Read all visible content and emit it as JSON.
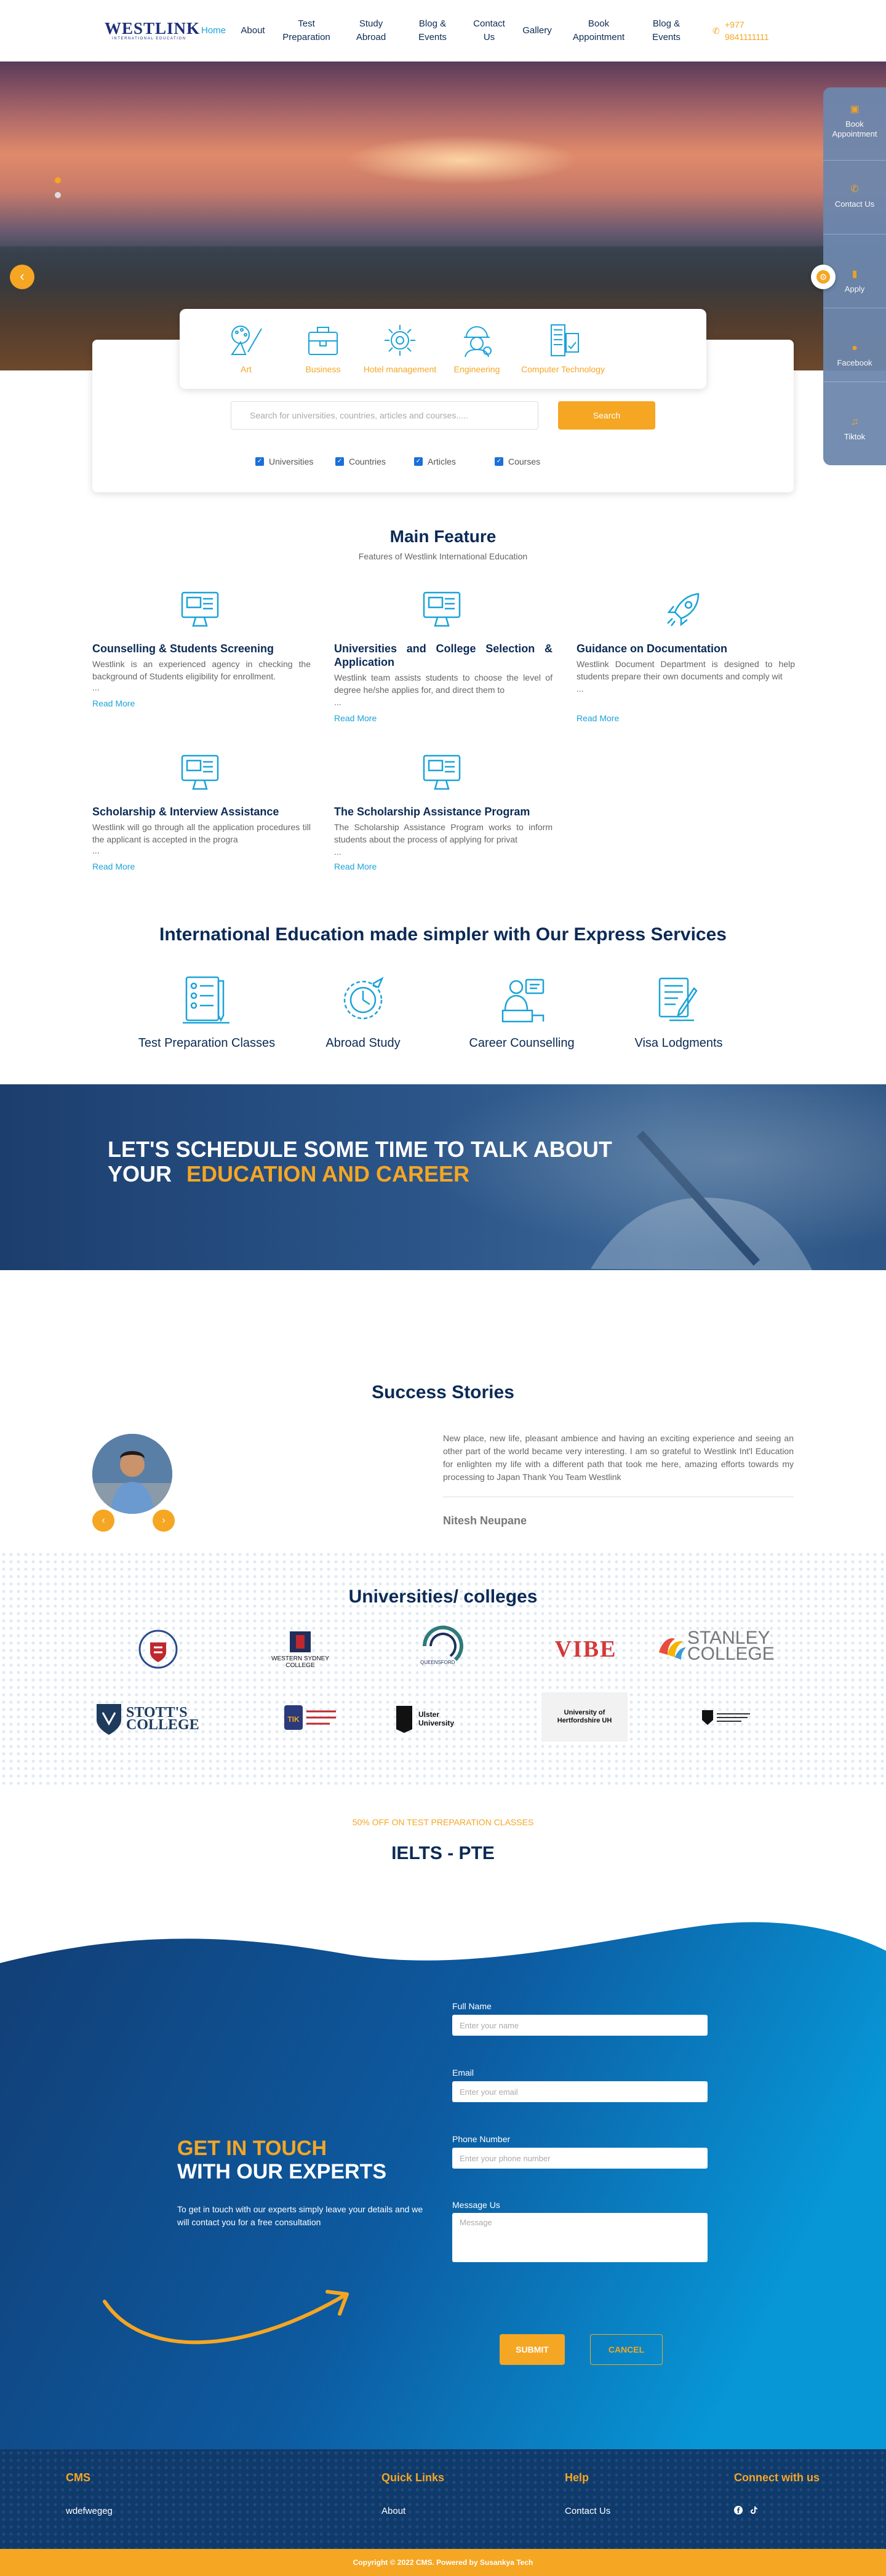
{
  "header": {
    "logo_main": "WESTLINK",
    "logo_sub": "INTERNATIONAL EDUCATION",
    "nav": [
      {
        "label": "Home"
      },
      {
        "label": "About"
      },
      {
        "label": "Test\nPreparation"
      },
      {
        "label": "Study\nAbroad"
      },
      {
        "label": "Blog &\nEvents"
      },
      {
        "label": "Contact\nUs"
      },
      {
        "label": "Gallery"
      },
      {
        "label": "Book\nAppointment"
      },
      {
        "label": "Blog &\nEvents"
      }
    ],
    "phone_line1": "+977",
    "phone_line2": "9841111111",
    "active_color": "#1aa3d9",
    "accent_color": "#f5a623"
  },
  "sidebar": {
    "items": [
      {
        "label": "Book Appointment",
        "icon": "calendar-icon"
      },
      {
        "label": "Contact Us",
        "icon": "phone-icon"
      },
      {
        "label": "Apply",
        "icon": "document-icon"
      },
      {
        "label": "Facebook",
        "icon": "facebook-icon"
      },
      {
        "label": "Tiktok",
        "icon": "tiktok-icon"
      }
    ]
  },
  "search": {
    "categories": [
      {
        "label": "Art",
        "icon": "art-icon"
      },
      {
        "label": "Business",
        "icon": "briefcase-icon"
      },
      {
        "label": "Hotel management",
        "icon": "gear-brain-icon"
      },
      {
        "label": "Engineering",
        "icon": "engineer-icon"
      },
      {
        "label": "Computer Technology",
        "icon": "computer-icon"
      }
    ],
    "placeholder": "Search for universities, countries, articles and courses.....",
    "button": "Search",
    "filters": [
      {
        "label": "Universities",
        "checked": true
      },
      {
        "label": "Countries",
        "checked": true
      },
      {
        "label": "Articles",
        "checked": true
      },
      {
        "label": "Courses",
        "checked": true
      }
    ]
  },
  "main_feature": {
    "title": "Main Feature",
    "subtitle": "Features of Westlink International Education",
    "items": [
      {
        "title": "Counselling & Students Screening",
        "text": "Westlink is an experienced agency in checking the background of Students eligibility for enrollment.",
        "dots": "...",
        "read_more": "Read More"
      },
      {
        "title": "Universities and College Selection & Application",
        "text": "Westlink team assists students to choose the level of degree he/she applies for, and direct them to",
        "dots": "...",
        "read_more": "Read More"
      },
      {
        "title": "Guidance on Documentation",
        "text": "Westlink Document Department is designed to help students prepare their own documents and comply wit",
        "dots": "...",
        "read_more": "Read More"
      },
      {
        "title": "Scholarship & Interview Assistance",
        "text": "Westlink will go through all the application procedures till the applicant is accepted in the progra",
        "dots": "...",
        "read_more": "Read More"
      },
      {
        "title": "The Scholarship Assistance Program",
        "text": "The Scholarship Assistance Program works to inform students about the process of applying for privat",
        "dots": "...",
        "read_more": "Read More"
      }
    ]
  },
  "express": {
    "title": "International Education made simpler with Our Express Services",
    "items": [
      {
        "label": "Test Preparation Classes",
        "icon": "test-prep-icon"
      },
      {
        "label": "Abroad Study",
        "icon": "globe-plane-icon"
      },
      {
        "label": "Career Counselling",
        "icon": "counsellor-icon"
      },
      {
        "label": "Visa Lodgments",
        "icon": "visa-document-icon"
      }
    ]
  },
  "banner": {
    "line1": "LET'S SCHEDULE SOME TIME TO TALK ABOUT",
    "line2_prefix": "YOUR",
    "line2_highlight": "EDUCATION AND CAREER"
  },
  "success": {
    "title": "Success Stories",
    "quote": "New place, new life, pleasant ambience and having an exciting experience and seeing an other part of the world became very interesting. I am so grateful to Westlink Int'l Education for enlighten my life with a different path that took me here, amazing efforts towards my processing to Japan Thank You Team Westlink",
    "name": "Nitesh Neupane"
  },
  "universities": {
    "title": "Universities/ colleges",
    "logos": [
      {
        "text": ""
      },
      {
        "text": "WESTERN SYDNEY COLLEGE"
      },
      {
        "text": "QUEENSFORD"
      },
      {
        "text": "VIBE"
      },
      {
        "text": "STANLEY COLLEGE"
      },
      {
        "text": "STOTT'S COLLEGE"
      },
      {
        "text": ""
      },
      {
        "text": "Ulster University"
      },
      {
        "text": "University of Hertfordshire UH"
      },
      {
        "text": ""
      }
    ]
  },
  "ielts": {
    "offer": "50% OFF ON TEST PREPARATION CLASSES",
    "title": "IELTS - PTE"
  },
  "contact": {
    "heading1": "GET IN TOUCH",
    "heading2": "WITH OUR EXPERTS",
    "text": "To get in touch with our experts simply leave your details and we will contact you for a free consultation",
    "fields": [
      {
        "label": "Full Name",
        "placeholder": "Enter your name"
      },
      {
        "label": "Email",
        "placeholder": "Enter your email"
      },
      {
        "label": "Phone Number",
        "placeholder": "Enter your phone number"
      },
      {
        "label": "Message Us",
        "placeholder": "Message"
      }
    ],
    "submit": "SUBMIT",
    "cancel": "CANCEL"
  },
  "footer": {
    "columns": [
      {
        "heading": "CMS",
        "link": "wdefwegeg"
      },
      {
        "heading": "Quick Links",
        "link": "About"
      },
      {
        "heading": "Help",
        "link": "Contact Us"
      },
      {
        "heading": "Connect with us",
        "link": ""
      }
    ],
    "copyright": "Copyright © 2022 CMS. Powered by Susankya Tech"
  }
}
